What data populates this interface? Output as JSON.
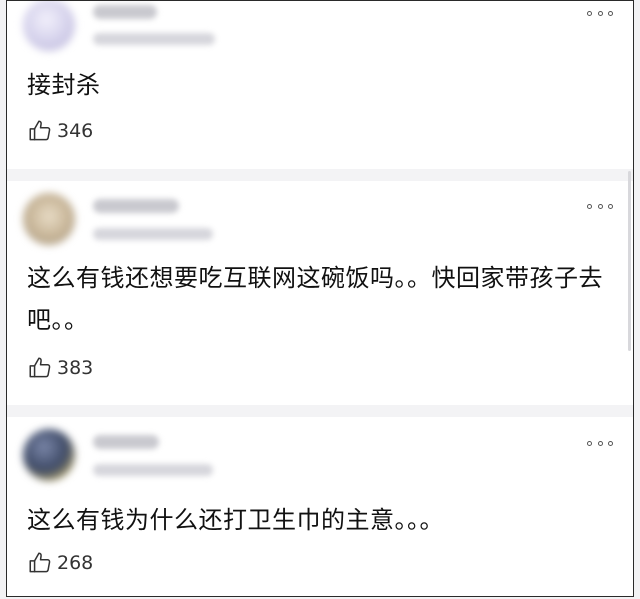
{
  "comments": [
    {
      "text": "接封杀",
      "likes": "346",
      "avatar_color": "#d9d6ee"
    },
    {
      "text": "这么有钱还想要吃互联网这碗饭吗。。快回家带孩子去吧。。",
      "likes": "383",
      "avatar_color": "#c9b79a"
    },
    {
      "text": "这么有钱为什么还打卫生巾的主意。。。",
      "likes": "268",
      "avatar_color": "#3e4a66"
    }
  ],
  "icons": {
    "like": "thumbs-up-icon",
    "more": "more-options-icon"
  }
}
